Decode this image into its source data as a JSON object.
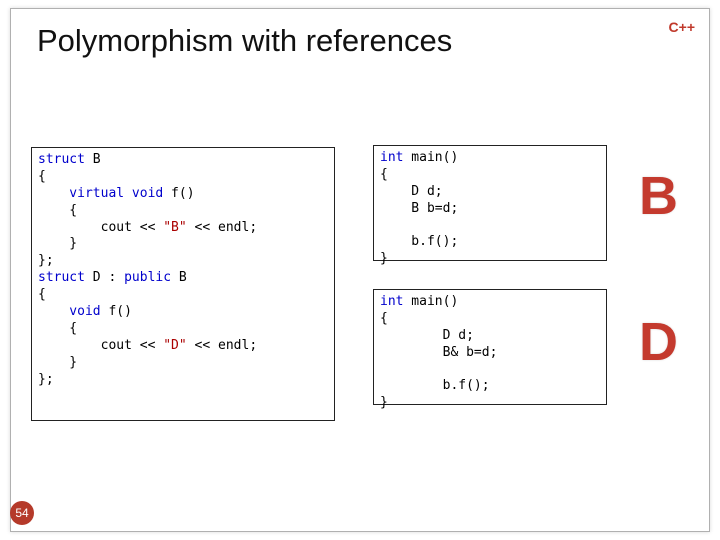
{
  "lang_label": "C++",
  "title": "Polymorphism with references",
  "code_left": {
    "l1a": "struct",
    "l1b": " B",
    "l2": "{",
    "l3a": "    virtual",
    "l3b": " ",
    "l3c": "void",
    "l3d": " f()",
    "l4": "    {",
    "l5a": "        cout << ",
    "l5b": "\"B\"",
    "l5c": " << endl;",
    "l6": "    }",
    "l7": "};",
    "l8a": "struct",
    "l8b": " D : ",
    "l8c": "public",
    "l8d": " B",
    "l9": "{",
    "l10a": "    void",
    "l10b": " f()",
    "l11": "    {",
    "l12a": "        cout << ",
    "l12b": "\"D\"",
    "l12c": " << endl;",
    "l13": "    }",
    "l14": "};"
  },
  "code_rt": {
    "l1a": "int",
    "l1b": " main()",
    "l2": "{",
    "l3": "    D d;",
    "l4": "    B b=d;",
    "l5": "",
    "l6": "    b.f();",
    "l7": "}"
  },
  "code_rb": {
    "l1a": "int",
    "l1b": " main()",
    "l2": "{",
    "l3": "        D d;",
    "l4": "        B& b=d;",
    "l5": "",
    "l6": "        b.f();",
    "l7": "}"
  },
  "letter_b": "B",
  "letter_d": "D",
  "slide_number": "54"
}
